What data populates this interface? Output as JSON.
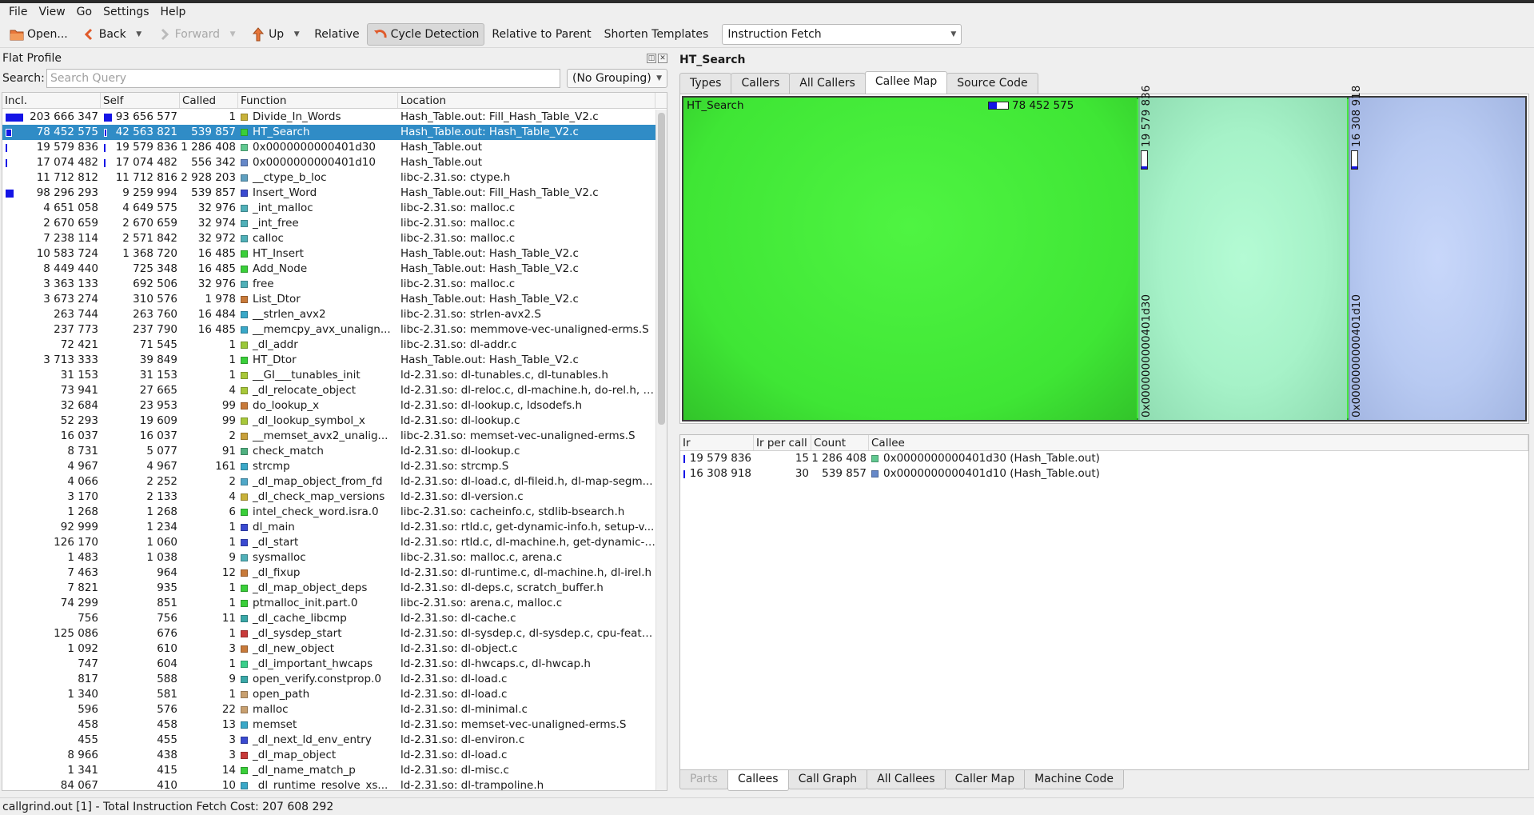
{
  "menu": [
    "File",
    "View",
    "Go",
    "Settings",
    "Help"
  ],
  "toolbar": {
    "open": "Open...",
    "back": "Back",
    "forward": "Forward",
    "up": "Up",
    "relative": "Relative",
    "cycle_detection": "Cycle Detection",
    "relative_to_parent": "Relative to Parent",
    "shorten_templates": "Shorten Templates",
    "event_type": "Instruction Fetch"
  },
  "flat_profile": {
    "title": "Flat Profile",
    "search_label": "Search:",
    "search_placeholder": "Search Query",
    "search_value": "",
    "grouping": "(No Grouping)",
    "columns": [
      "Incl.",
      "Self",
      "Called",
      "Function",
      "Location"
    ],
    "rows": [
      {
        "incl": "203 666 347",
        "self": "93 656 577",
        "called": "1",
        "func": "Divide_In_Words",
        "loc": "Hash_Table.out: Fill_Hash_Table_V2.c",
        "color": "#c8b23a",
        "ibar": 0.98,
        "sbar": 0.45
      },
      {
        "incl": "78 452 575",
        "self": "42 563 821",
        "called": "539 857",
        "func": "HT_Search",
        "loc": "Hash_Table.out: Hash_Table_V2.c",
        "color": "#3acf3a",
        "ibar": 0.38,
        "sbar": 0.2,
        "selected": true
      },
      {
        "incl": "19 579 836",
        "self": "19 579 836",
        "called": "1 286 408",
        "func": "0x0000000000401d30",
        "loc": "Hash_Table.out",
        "color": "#60c890",
        "ibar": 0.09,
        "sbar": 0.09
      },
      {
        "incl": "17 074 482",
        "self": "17 074 482",
        "called": "556 342",
        "func": "0x0000000000401d10",
        "loc": "Hash_Table.out",
        "color": "#6688c8",
        "ibar": 0.08,
        "sbar": 0.08
      },
      {
        "incl": "11 712 812",
        "self": "11 712 816",
        "called": "2 928 203",
        "func": "__ctype_b_loc",
        "loc": "libc-2.31.so: ctype.h",
        "color": "#5fa0c0",
        "ibar": 0.0,
        "sbar": 0.0
      },
      {
        "incl": "98 296 293",
        "self": "9 259 994",
        "called": "539 857",
        "func": "Insert_Word",
        "loc": "Hash_Table.out: Fill_Hash_Table_V2.c",
        "color": "#3a4ad0",
        "ibar": 0.47,
        "sbar": 0.0
      },
      {
        "incl": "4 651 058",
        "self": "4 649 575",
        "called": "32 976",
        "func": "_int_malloc",
        "loc": "libc-2.31.so: malloc.c",
        "color": "#50b0b8",
        "ibar": 0,
        "sbar": 0
      },
      {
        "incl": "2 670 659",
        "self": "2 670 659",
        "called": "32 974",
        "func": "_int_free",
        "loc": "libc-2.31.so: malloc.c",
        "color": "#50b0b8",
        "ibar": 0,
        "sbar": 0
      },
      {
        "incl": "7 238 114",
        "self": "2 571 842",
        "called": "32 972",
        "func": "calloc",
        "loc": "libc-2.31.so: malloc.c",
        "color": "#50b0b8",
        "ibar": 0,
        "sbar": 0
      },
      {
        "incl": "10 583 724",
        "self": "1 368 720",
        "called": "16 485",
        "func": "HT_Insert",
        "loc": "Hash_Table.out: Hash_Table_V2.c",
        "color": "#3acf3a",
        "ibar": 0,
        "sbar": 0
      },
      {
        "incl": "8 449 440",
        "self": "725 348",
        "called": "16 485",
        "func": "Add_Node",
        "loc": "Hash_Table.out: Hash_Table_V2.c",
        "color": "#3acf3a",
        "ibar": 0,
        "sbar": 0
      },
      {
        "incl": "3 363 133",
        "self": "692 506",
        "called": "32 976",
        "func": "free",
        "loc": "libc-2.31.so: malloc.c",
        "color": "#50b0b8",
        "ibar": 0,
        "sbar": 0
      },
      {
        "incl": "3 673 274",
        "self": "310 576",
        "called": "1 978",
        "func": "List_Dtor",
        "loc": "Hash_Table.out: Hash_Table_V2.c",
        "color": "#c87a3a",
        "ibar": 0,
        "sbar": 0
      },
      {
        "incl": "263 744",
        "self": "263 760",
        "called": "16 484",
        "func": "__strlen_avx2",
        "loc": "libc-2.31.so: strlen-avx2.S",
        "color": "#3aa8c8",
        "ibar": 0,
        "sbar": 0
      },
      {
        "incl": "237 773",
        "self": "237 790",
        "called": "16 485",
        "func": "__memcpy_avx_unalign...",
        "loc": "libc-2.31.so: memmove-vec-unaligned-erms.S",
        "color": "#3aa8c8",
        "ibar": 0,
        "sbar": 0
      },
      {
        "incl": "72 421",
        "self": "71 545",
        "called": "1",
        "func": "_dl_addr",
        "loc": "libc-2.31.so: dl-addr.c",
        "color": "#9ac83a",
        "ibar": 0,
        "sbar": 0
      },
      {
        "incl": "3 713 333",
        "self": "39 849",
        "called": "1",
        "func": "HT_Dtor",
        "loc": "Hash_Table.out: Hash_Table_V2.c",
        "color": "#3acf3a",
        "ibar": 0,
        "sbar": 0
      },
      {
        "incl": "31 153",
        "self": "31 153",
        "called": "1",
        "func": "__GI___tunables_init",
        "loc": "ld-2.31.so: dl-tunables.c, dl-tunables.h",
        "color": "#a8c83a",
        "ibar": 0,
        "sbar": 0
      },
      {
        "incl": "73 941",
        "self": "27 665",
        "called": "4",
        "func": "_dl_relocate_object",
        "loc": "ld-2.31.so: dl-reloc.c, dl-machine.h, do-rel.h, l...",
        "color": "#a8c83a",
        "ibar": 0,
        "sbar": 0
      },
      {
        "incl": "32 684",
        "self": "23 953",
        "called": "99",
        "func": "do_lookup_x",
        "loc": "ld-2.31.so: dl-lookup.c, ldsodefs.h",
        "color": "#c87a3a",
        "ibar": 0,
        "sbar": 0
      },
      {
        "incl": "52 293",
        "self": "19 609",
        "called": "99",
        "func": "_dl_lookup_symbol_x",
        "loc": "ld-2.31.so: dl-lookup.c",
        "color": "#a8c83a",
        "ibar": 0,
        "sbar": 0
      },
      {
        "incl": "16 037",
        "self": "16 037",
        "called": "2",
        "func": "__memset_avx2_unalig...",
        "loc": "libc-2.31.so: memset-vec-unaligned-erms.S",
        "color": "#c8a03a",
        "ibar": 0,
        "sbar": 0
      },
      {
        "incl": "8 731",
        "self": "5 077",
        "called": "91",
        "func": "check_match",
        "loc": "ld-2.31.so: dl-lookup.c",
        "color": "#50b080",
        "ibar": 0,
        "sbar": 0
      },
      {
        "incl": "4 967",
        "self": "4 967",
        "called": "161",
        "func": "strcmp",
        "loc": "ld-2.31.so: strcmp.S",
        "color": "#3aa8c8",
        "ibar": 0,
        "sbar": 0
      },
      {
        "incl": "4 066",
        "self": "2 252",
        "called": "2",
        "func": "_dl_map_object_from_fd",
        "loc": "ld-2.31.so: dl-load.c, dl-fileid.h, dl-map-segm...",
        "color": "#50a8c8",
        "ibar": 0,
        "sbar": 0
      },
      {
        "incl": "3 170",
        "self": "2 133",
        "called": "4",
        "func": "_dl_check_map_versions",
        "loc": "ld-2.31.so: dl-version.c",
        "color": "#c8b23a",
        "ibar": 0,
        "sbar": 0
      },
      {
        "incl": "1 268",
        "self": "1 268",
        "called": "6",
        "func": "intel_check_word.isra.0",
        "loc": "libc-2.31.so: cacheinfo.c, stdlib-bsearch.h",
        "color": "#3acf3a",
        "ibar": 0,
        "sbar": 0
      },
      {
        "incl": "92 999",
        "self": "1 234",
        "called": "1",
        "func": "dl_main",
        "loc": "ld-2.31.so: rtld.c, get-dynamic-info.h, setup-v...",
        "color": "#3a4ad0",
        "ibar": 0,
        "sbar": 0
      },
      {
        "incl": "126 170",
        "self": "1 060",
        "called": "1",
        "func": "_dl_start",
        "loc": "ld-2.31.so: rtld.c, dl-machine.h, get-dynamic-i...",
        "color": "#3a4ad0",
        "ibar": 0,
        "sbar": 0
      },
      {
        "incl": "1 483",
        "self": "1 038",
        "called": "9",
        "func": "sysmalloc",
        "loc": "libc-2.31.so: malloc.c, arena.c",
        "color": "#50b0b8",
        "ibar": 0,
        "sbar": 0
      },
      {
        "incl": "7 463",
        "self": "964",
        "called": "12",
        "func": "_dl_fixup",
        "loc": "ld-2.31.so: dl-runtime.c, dl-machine.h, dl-irel.h",
        "color": "#c87a3a",
        "ibar": 0,
        "sbar": 0
      },
      {
        "incl": "7 821",
        "self": "935",
        "called": "1",
        "func": "_dl_map_object_deps",
        "loc": "ld-2.31.so: dl-deps.c, scratch_buffer.h",
        "color": "#3acf3a",
        "ibar": 0,
        "sbar": 0
      },
      {
        "incl": "74 299",
        "self": "851",
        "called": "1",
        "func": "ptmalloc_init.part.0",
        "loc": "libc-2.31.so: arena.c, malloc.c",
        "color": "#3acf3a",
        "ibar": 0,
        "sbar": 0
      },
      {
        "incl": "756",
        "self": "756",
        "called": "11",
        "func": "_dl_cache_libcmp",
        "loc": "ld-2.31.so: dl-cache.c",
        "color": "#3aa8a8",
        "ibar": 0,
        "sbar": 0
      },
      {
        "incl": "125 086",
        "self": "676",
        "called": "1",
        "func": "_dl_sysdep_start",
        "loc": "ld-2.31.so: dl-sysdep.c, dl-sysdep.c, cpu-featu...",
        "color": "#c83a3a",
        "ibar": 0,
        "sbar": 0
      },
      {
        "incl": "1 092",
        "self": "610",
        "called": "3",
        "func": "_dl_new_object",
        "loc": "ld-2.31.so: dl-object.c",
        "color": "#c87a3a",
        "ibar": 0,
        "sbar": 0
      },
      {
        "incl": "747",
        "self": "604",
        "called": "1",
        "func": "_dl_important_hwcaps",
        "loc": "ld-2.31.so: dl-hwcaps.c, dl-hwcap.h",
        "color": "#3acf8a",
        "ibar": 0,
        "sbar": 0
      },
      {
        "incl": "817",
        "self": "588",
        "called": "9",
        "func": "open_verify.constprop.0",
        "loc": "ld-2.31.so: dl-load.c",
        "color": "#3aa8a8",
        "ibar": 0,
        "sbar": 0
      },
      {
        "incl": "1 340",
        "self": "581",
        "called": "1",
        "func": "open_path",
        "loc": "ld-2.31.so: dl-load.c",
        "color": "#c8a070",
        "ibar": 0,
        "sbar": 0
      },
      {
        "incl": "596",
        "self": "576",
        "called": "22",
        "func": "malloc",
        "loc": "ld-2.31.so: dl-minimal.c",
        "color": "#c8a070",
        "ibar": 0,
        "sbar": 0
      },
      {
        "incl": "458",
        "self": "458",
        "called": "13",
        "func": "memset",
        "loc": "ld-2.31.so: memset-vec-unaligned-erms.S",
        "color": "#3aa8c8",
        "ibar": 0,
        "sbar": 0
      },
      {
        "incl": "455",
        "self": "455",
        "called": "3",
        "func": "_dl_next_ld_env_entry",
        "loc": "ld-2.31.so: dl-environ.c",
        "color": "#3a4ad0",
        "ibar": 0,
        "sbar": 0
      },
      {
        "incl": "8 966",
        "self": "438",
        "called": "3",
        "func": "_dl_map_object",
        "loc": "ld-2.31.so: dl-load.c",
        "color": "#c83a3a",
        "ibar": 0,
        "sbar": 0
      },
      {
        "incl": "1 341",
        "self": "415",
        "called": "14",
        "func": "_dl_name_match_p",
        "loc": "ld-2.31.so: dl-misc.c",
        "color": "#3acf3a",
        "ibar": 0,
        "sbar": 0
      },
      {
        "incl": "84 067",
        "self": "410",
        "called": "10",
        "func": "_dl_runtime_resolve_xs...",
        "loc": "ld-2.31.so: dl-trampoline.h",
        "color": "#3aa8c8",
        "ibar": 0,
        "sbar": 0
      }
    ]
  },
  "right": {
    "function_name": "HT_Search",
    "top_tabs": [
      "Types",
      "Callers",
      "All Callers",
      "Callee Map",
      "Source Code"
    ],
    "top_active": "Callee Map",
    "treemap": {
      "root_label": "HT_Search",
      "root_cost": "78 452 575",
      "child1_cost": "19 579 836",
      "child1_name": "0x0000000000401d30",
      "child2_cost": "16 308 918",
      "child2_name": "0x0000000000401d10"
    },
    "callee_columns": [
      "Ir",
      "Ir per call",
      "Count",
      "Callee"
    ],
    "callees": [
      {
        "ir": "19 579 836",
        "ipc": "15",
        "count": "1 286 408",
        "callee": "0x0000000000401d30 (Hash_Table.out)",
        "color": "#60c890"
      },
      {
        "ir": "16 308 918",
        "ipc": "30",
        "count": "539 857",
        "callee": "0x0000000000401d10 (Hash_Table.out)",
        "color": "#6688c8"
      }
    ],
    "bottom_tabs": [
      "Parts",
      "Callees",
      "Call Graph",
      "All Callees",
      "Caller Map",
      "Machine Code"
    ],
    "bottom_active": "Callees"
  },
  "status": "callgrind.out [1] - Total Instruction Fetch Cost: 207 608 292"
}
